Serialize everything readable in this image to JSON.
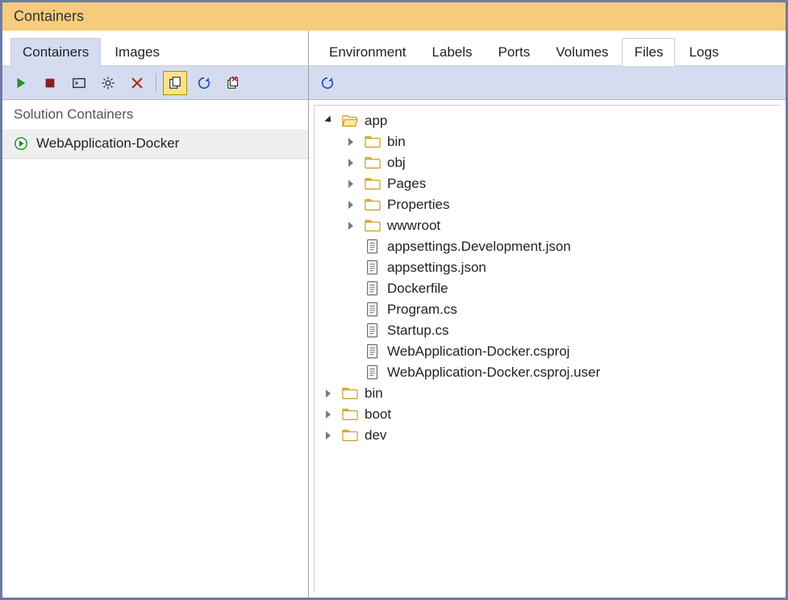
{
  "title": "Containers",
  "left": {
    "tabs": [
      {
        "label": "Containers",
        "active": true
      },
      {
        "label": "Images",
        "active": false
      }
    ],
    "toolbar_icons": [
      "play-icon",
      "stop-icon",
      "terminal-icon",
      "gear-icon",
      "delete-icon",
      "sep",
      "copy-icon",
      "refresh-icon",
      "close-multi-icon"
    ],
    "toolbar_selected_index": 5,
    "section_label": "Solution Containers",
    "containers": [
      {
        "name": "WebApplication-Docker",
        "status": "running"
      }
    ]
  },
  "right": {
    "tabs": [
      {
        "label": "Environment",
        "active": false
      },
      {
        "label": "Labels",
        "active": false
      },
      {
        "label": "Ports",
        "active": false
      },
      {
        "label": "Volumes",
        "active": false
      },
      {
        "label": "Files",
        "active": true
      },
      {
        "label": "Logs",
        "active": false
      }
    ],
    "toolbar_icons": [
      "refresh-icon"
    ],
    "tree": [
      {
        "name": "app",
        "type": "folder",
        "expanded": true,
        "children": [
          {
            "name": "bin",
            "type": "folder",
            "expanded": false
          },
          {
            "name": "obj",
            "type": "folder",
            "expanded": false
          },
          {
            "name": "Pages",
            "type": "folder",
            "expanded": false
          },
          {
            "name": "Properties",
            "type": "folder",
            "expanded": false
          },
          {
            "name": "wwwroot",
            "type": "folder",
            "expanded": false
          },
          {
            "name": "appsettings.Development.json",
            "type": "file"
          },
          {
            "name": "appsettings.json",
            "type": "file"
          },
          {
            "name": "Dockerfile",
            "type": "file"
          },
          {
            "name": "Program.cs",
            "type": "file"
          },
          {
            "name": "Startup.cs",
            "type": "file"
          },
          {
            "name": "WebApplication-Docker.csproj",
            "type": "file"
          },
          {
            "name": "WebApplication-Docker.csproj.user",
            "type": "file"
          }
        ]
      },
      {
        "name": "bin",
        "type": "folder",
        "expanded": false
      },
      {
        "name": "boot",
        "type": "folder",
        "expanded": false
      },
      {
        "name": "dev",
        "type": "folder",
        "expanded": false
      }
    ]
  }
}
